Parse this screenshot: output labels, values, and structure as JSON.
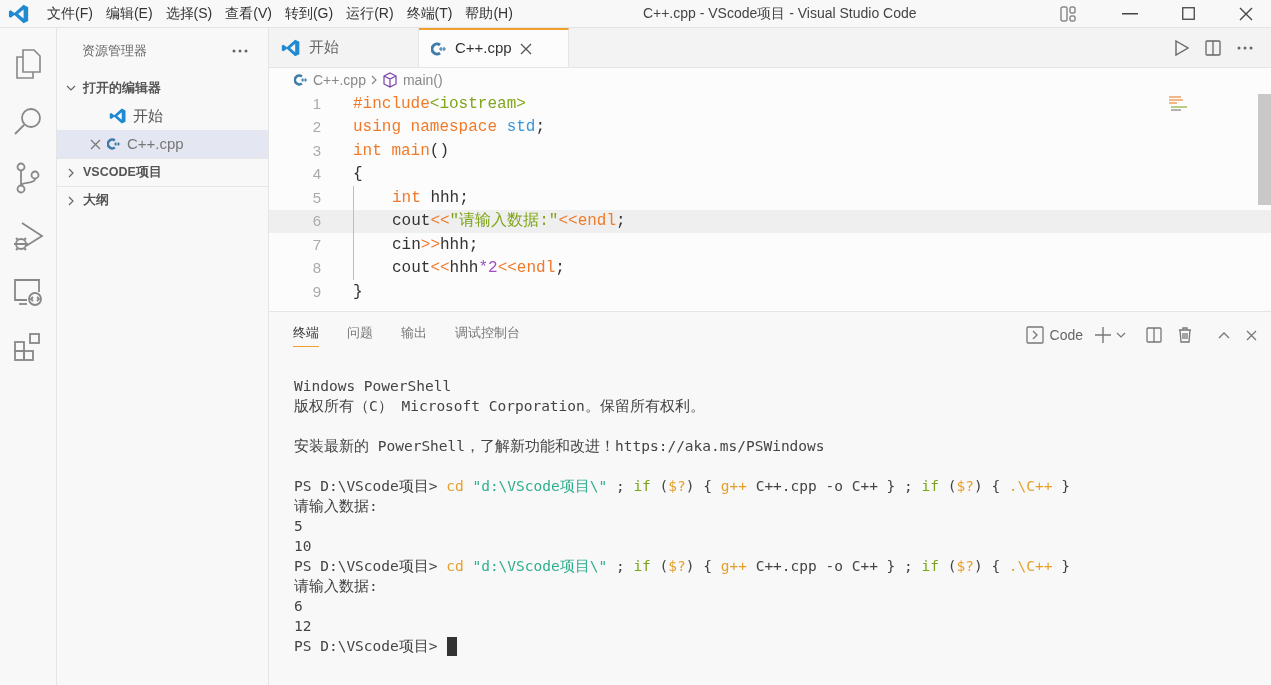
{
  "window": {
    "title": "C++.cpp - VScode项目 - Visual Studio Code"
  },
  "menu": [
    "文件(F)",
    "编辑(E)",
    "选择(S)",
    "查看(V)",
    "转到(G)",
    "运行(R)",
    "终端(T)",
    "帮助(H)"
  ],
  "sidebar": {
    "title": "资源管理器",
    "sections": [
      {
        "label": "打开的编辑器",
        "expanded": true,
        "items": [
          {
            "label": "开始",
            "kind": "welcome",
            "selected": false
          },
          {
            "label": "C++.cpp",
            "kind": "cpp",
            "selected": true
          }
        ]
      },
      {
        "label": "VSCODE项目",
        "expanded": false
      },
      {
        "label": "大纲",
        "expanded": false
      }
    ]
  },
  "tabs": [
    {
      "label": "开始",
      "kind": "welcome",
      "selected": false
    },
    {
      "label": "C++.cpp",
      "kind": "cpp",
      "selected": true
    }
  ],
  "breadcrumbs": [
    {
      "label": "C++.cpp",
      "kind": "cpp"
    },
    {
      "label": "main()",
      "kind": "symbol"
    }
  ],
  "code_lines": [
    {
      "number": "1",
      "current": false,
      "tokens": [
        {
          "text": "#include",
          "kind": "kw"
        },
        {
          "text": "<iostream>",
          "kind": "str"
        }
      ]
    },
    {
      "number": "2",
      "current": false,
      "tokens": [
        {
          "text": "using namespace",
          "kind": "kw"
        },
        {
          "text": " std",
          "kind": "type"
        },
        {
          "text": ";",
          "kind": "plain"
        }
      ]
    },
    {
      "number": "3",
      "current": false,
      "tokens": [
        {
          "text": "int main",
          "kind": "kw"
        },
        {
          "text": "()",
          "kind": "plain"
        }
      ]
    },
    {
      "number": "4",
      "current": false,
      "tokens": [
        {
          "text": "{",
          "kind": "plain"
        }
      ],
      "children": [
        {
          "number": "5",
          "current": false,
          "tokens": [
            {
              "text": "int",
              "kind": "kw"
            },
            {
              "text": " hhh;",
              "kind": "plain"
            }
          ]
        },
        {
          "number": "6",
          "current": true,
          "tokens": [
            {
              "text": "cout",
              "kind": "plain"
            },
            {
              "text": "<<",
              "kind": "kw"
            },
            {
              "text": "\"请输入数据:\"",
              "kind": "str"
            },
            {
              "text": "<<endl",
              "kind": "kw"
            },
            {
              "text": ";",
              "kind": "plain"
            }
          ]
        },
        {
          "number": "7",
          "current": false,
          "tokens": [
            {
              "text": "cin",
              "kind": "plain"
            },
            {
              "text": ">>",
              "kind": "kw"
            },
            {
              "text": "hhh;",
              "kind": "plain"
            }
          ]
        },
        {
          "number": "8",
          "current": false,
          "tokens": [
            {
              "text": "cout",
              "kind": "plain"
            },
            {
              "text": "<<",
              "kind": "kw"
            },
            {
              "text": "hhh",
              "kind": "plain"
            },
            {
              "text": "*2",
              "kind": "num"
            },
            {
              "text": "<<endl",
              "kind": "kw"
            },
            {
              "text": ";",
              "kind": "plain"
            }
          ]
        }
      ]
    },
    {
      "number": "9",
      "current": false,
      "tokens": [
        {
          "text": "}",
          "kind": "plain"
        }
      ]
    }
  ],
  "panel": {
    "tabs": [
      {
        "label": "终端",
        "selected": true
      },
      {
        "label": "问题",
        "selected": false
      },
      {
        "label": "输出",
        "selected": false
      },
      {
        "label": "调试控制台",
        "selected": false
      }
    ],
    "terminal_name": "Code",
    "blocks": [
      {
        "lines": [
          {
            "segments": [
              {
                "text": "Windows PowerShell",
                "kind": "plain"
              }
            ]
          },
          {
            "segments": [
              {
                "text": "版权所有（C） Microsoft Corporation。保留所有权利。",
                "kind": "plain"
              }
            ]
          }
        ]
      },
      {
        "lines": [
          {
            "segments": [
              {
                "text": "安装最新的 PowerShell，了解新功能和改进！https://aka.ms/PSWindows",
                "kind": "plain"
              }
            ]
          }
        ]
      },
      {
        "lines": [
          {
            "segments": [
              {
                "text": "PS D:\\VScode项目> ",
                "kind": "plain"
              },
              {
                "text": "cd",
                "kind": "cmd"
              },
              {
                "text": " \"d:\\VScode项目\\\"",
                "kind": "str"
              },
              {
                "text": " ; ",
                "kind": "plain"
              },
              {
                "text": "if",
                "kind": "kw"
              },
              {
                "text": " (",
                "kind": "plain"
              },
              {
                "text": "$?",
                "kind": "cmd"
              },
              {
                "text": ") { ",
                "kind": "plain"
              },
              {
                "text": "g++",
                "kind": "cmd"
              },
              {
                "text": " C++.cpp -o C++ } ; ",
                "kind": "plain"
              },
              {
                "text": "if",
                "kind": "kw"
              },
              {
                "text": " (",
                "kind": "plain"
              },
              {
                "text": "$?",
                "kind": "cmd"
              },
              {
                "text": ") { ",
                "kind": "plain"
              },
              {
                "text": ".\\C++",
                "kind": "cmd"
              },
              {
                "text": " }",
                "kind": "plain"
              }
            ]
          },
          {
            "segments": [
              {
                "text": "请输入数据:",
                "kind": "plain"
              }
            ]
          },
          {
            "segments": [
              {
                "text": "5",
                "kind": "plain"
              }
            ]
          },
          {
            "segments": [
              {
                "text": "10",
                "kind": "plain"
              }
            ]
          },
          {
            "segments": [
              {
                "text": "PS D:\\VScode项目> ",
                "kind": "plain"
              },
              {
                "text": "cd",
                "kind": "cmd"
              },
              {
                "text": " \"d:\\VScode项目\\\"",
                "kind": "str"
              },
              {
                "text": " ; ",
                "kind": "plain"
              },
              {
                "text": "if",
                "kind": "kw"
              },
              {
                "text": " (",
                "kind": "plain"
              },
              {
                "text": "$?",
                "kind": "cmd"
              },
              {
                "text": ") { ",
                "kind": "plain"
              },
              {
                "text": "g++",
                "kind": "cmd"
              },
              {
                "text": " C++.cpp -o C++ } ; ",
                "kind": "plain"
              },
              {
                "text": "if",
                "kind": "kw"
              },
              {
                "text": " (",
                "kind": "plain"
              },
              {
                "text": "$?",
                "kind": "cmd"
              },
              {
                "text": ") { ",
                "kind": "plain"
              },
              {
                "text": ".\\C++",
                "kind": "cmd"
              },
              {
                "text": " }",
                "kind": "plain"
              }
            ]
          },
          {
            "segments": [
              {
                "text": "请输入数据:",
                "kind": "plain"
              }
            ]
          },
          {
            "segments": [
              {
                "text": "6",
                "kind": "plain"
              }
            ]
          },
          {
            "segments": [
              {
                "text": "12",
                "kind": "plain"
              }
            ]
          },
          {
            "segments": [
              {
                "text": "PS D:\\VScode项目>",
                "kind": "plain"
              }
            ],
            "cursor": true
          }
        ]
      }
    ]
  }
}
